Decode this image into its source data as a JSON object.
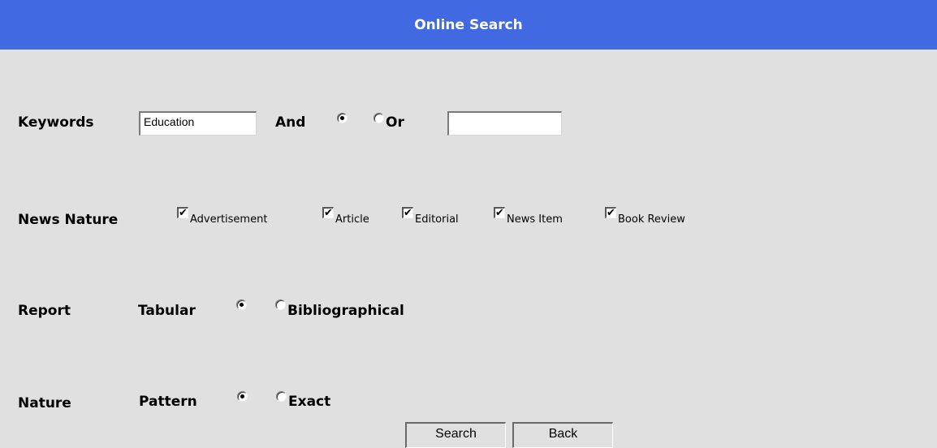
{
  "title": "Online Search",
  "keywords": {
    "label": "Keywords",
    "value1": "Education",
    "and_label": "And",
    "or_label": "Or",
    "value2": "",
    "selected": "And"
  },
  "news_nature": {
    "label": "News Nature",
    "options": [
      {
        "label": "Advertisement",
        "checked": true
      },
      {
        "label": "Article",
        "checked": true
      },
      {
        "label": "Editorial",
        "checked": true
      },
      {
        "label": "News Item",
        "checked": true
      },
      {
        "label": "Book Review",
        "checked": true
      }
    ]
  },
  "report": {
    "label": "Report",
    "option1": "Tabular",
    "option2": "Bibliographical",
    "selected": "Tabular"
  },
  "nature": {
    "label": "Nature",
    "option1": "Pattern",
    "option2": "Exact",
    "selected": "Pattern"
  },
  "buttons": {
    "search": "Search",
    "back": "Back"
  },
  "colors": {
    "title_bar": "#4169e1",
    "background": "#e0e0e0"
  }
}
